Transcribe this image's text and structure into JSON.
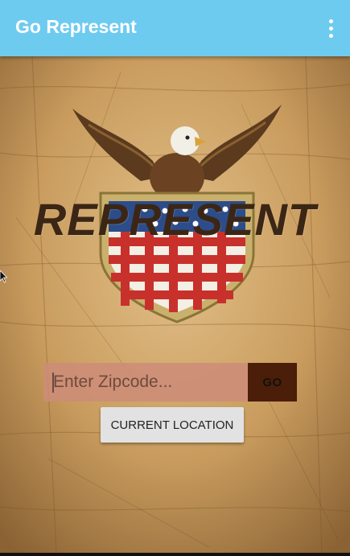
{
  "app_bar": {
    "title": "Go Represent",
    "menu_icon": "more-vert-icon",
    "color": "#6ecbf0"
  },
  "hero": {
    "title": "REPRESENT",
    "emblem": "eagle-shield-emblem"
  },
  "search": {
    "placeholder": "Enter Zipcode...",
    "value": "",
    "go_label": "GO"
  },
  "location_button": {
    "label": "CURRENT LOCATION"
  },
  "colors": {
    "accent": "#6ecbf0",
    "title_text": "#3b2616",
    "go_button": "#4a1e08",
    "input_bg": "#cd8c78"
  }
}
